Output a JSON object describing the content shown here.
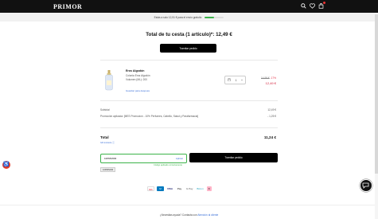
{
  "header": {
    "logo": "PRIMOR",
    "icons": [
      "search-icon",
      "heart-icon",
      "bag-icon"
    ]
  },
  "shipping_bar": {
    "text": "Estás a solo 12,51 € para el envío gratuito",
    "progress": 0.5
  },
  "cart": {
    "title": "Total de tu cesta (1 artículo)*: 12,49 €",
    "checkout_label": "Tramitar pedido"
  },
  "product": {
    "name": "Eros Algodón",
    "line1": "Colonia Eros Algodón",
    "line2": "Volumen (ML): 200",
    "wishlist": "Guardar para después",
    "quantity": "1",
    "old_price": "14,99 €",
    "discount": "-17%",
    "price": "12,49 €"
  },
  "summary": {
    "subtotal_label": "Subtotal",
    "subtotal_value": "12,49 €",
    "promo_label": "Promoción aplicada: [MES Promocion - 10% Perfumes, Cabello, Salud y Parafarmacia]",
    "promo_value": "- 1,25 €",
    "total_label": "Total",
    "total_value": "11,24 €",
    "total_sub": "IVA incluido ⓘ"
  },
  "coupon": {
    "code": "10PRIMOR",
    "apply": "Aplicar",
    "message": "Código aplicado correctamente",
    "chip": "10PRIMOR"
  },
  "payments": [
    "MC",
    "M",
    "VISA",
    "Pay",
    "G Pay",
    "Bizum",
    "K"
  ],
  "footer": {
    "text": "¿Necesitas ayuda? Contacta con",
    "link": "Atención al cliente"
  },
  "colors": {
    "accent_green": "#3cb34a",
    "price_red": "#d3213b",
    "link_blue": "#3a6fd8"
  }
}
